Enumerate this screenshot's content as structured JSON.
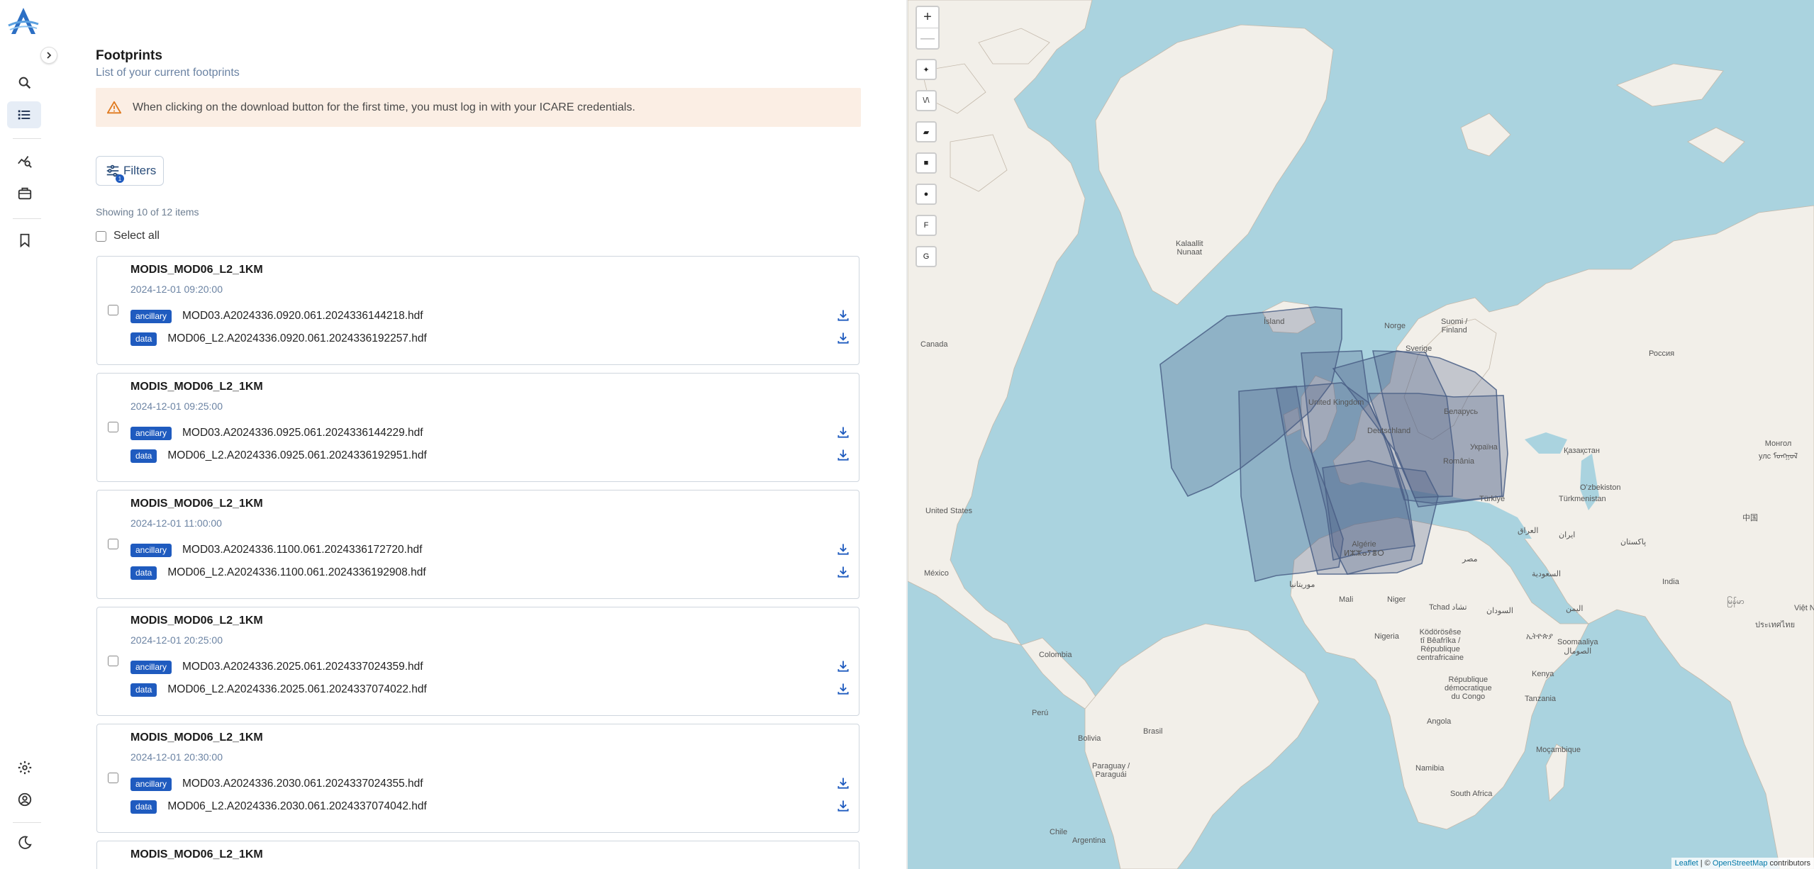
{
  "panel": {
    "title": "Footprints",
    "subtitle": "List of your current footprints",
    "alert_text": "When clicking on the download button for the first time, you must log in with your ICARE credentials.",
    "filters_label": "Filters",
    "filters_badge": "1",
    "showing": "Showing 10 of 12 items",
    "select_all": "Select all"
  },
  "tags": {
    "ancillary": "ancillary",
    "data": "data"
  },
  "cards": [
    {
      "title": "MODIS_MOD06_L2_1KM",
      "date": "2024-12-01 09:20:00",
      "ancillary_file": "MOD03.A2024336.0920.061.2024336144218.hdf",
      "data_file": "MOD06_L2.A2024336.0920.061.2024336192257.hdf"
    },
    {
      "title": "MODIS_MOD06_L2_1KM",
      "date": "2024-12-01 09:25:00",
      "ancillary_file": "MOD03.A2024336.0925.061.2024336144229.hdf",
      "data_file": "MOD06_L2.A2024336.0925.061.2024336192951.hdf"
    },
    {
      "title": "MODIS_MOD06_L2_1KM",
      "date": "2024-12-01 11:00:00",
      "ancillary_file": "MOD03.A2024336.1100.061.2024336172720.hdf",
      "data_file": "MOD06_L2.A2024336.1100.061.2024336192908.hdf"
    },
    {
      "title": "MODIS_MOD06_L2_1KM",
      "date": "2024-12-01 20:25:00",
      "ancillary_file": "MOD03.A2024336.2025.061.2024337024359.hdf",
      "data_file": "MOD06_L2.A2024336.2025.061.2024337074022.hdf"
    },
    {
      "title": "MODIS_MOD06_L2_1KM",
      "date": "2024-12-01 20:30:00",
      "ancillary_file": "MOD03.A2024336.2030.061.2024337024355.hdf",
      "data_file": "MOD06_L2.A2024336.2030.061.2024337074042.hdf"
    },
    {
      "title": "MODIS_MOD06_L2_1KM"
    }
  ],
  "map": {
    "zoom_in": "+",
    "zoom_out": "—",
    "tool_pin": "✦",
    "tool_polyline": "\\/\\",
    "tool_polygon": "▰",
    "tool_rectangle": "■",
    "tool_circle": "●",
    "tool_f": "F",
    "tool_g": "G",
    "labels": {
      "greenland": "Kalaallit\nNunaat",
      "island": "Ísland",
      "canada": "Canada",
      "norge": "Norge",
      "sverige": "Sverige",
      "suomi": "Suomi /\nFinland",
      "rossiya": "Россия",
      "kingdom": "Kingdom",
      "deutschland": "Deutschland",
      "belarus": "Беларусь",
      "ukraina": "Україна",
      "romania": "România",
      "kazakhstan": "Қазақстан",
      "mongol": "Монгол\nулс ᠮᠣᠩᠭᠣᠯ",
      "uzbekiston": "Oʻzbekiston",
      "turkmenistan": "Türkmenistan",
      "turkiye": "Türkiye",
      "us": "United States",
      "iraq": "العراق",
      "iran": "ایران",
      "pakistan": "پاکستان",
      "china": "中国",
      "mexico": "México",
      "misr": "مصر",
      "algerie": "Algérie\nⵍⵣⵣⴰⵢⴻⵔ",
      "mauritanie": "موريتانيا",
      "mali": "Mali",
      "niger": "Niger",
      "tchad": "Tchad تشاد",
      "sudan": "السودان",
      "saudi": "السعودية",
      "yemen": "اليمن",
      "india": "India",
      "vietnam": "Việt Nam",
      "myanmar": "မြန်မာ",
      "thailand": "ประเทศไทย",
      "nigeria": "Nigeria",
      "kodorosese": "Ködörösêse\ntî Bêafrîka /\nRépublique\ncentrafricaine",
      "ethiopia": "ኢትዮጵያ",
      "somalia": "Soomaaliya\nالصومال",
      "colombia": "Colombia",
      "rdc": "République\ndémocratique\ndu Congo",
      "kenya": "Kenya",
      "tanzania": "Tanzania",
      "peru": "Perú",
      "brasil": "Brasil",
      "bolivia": "Bolivia",
      "angola": "Angola",
      "mocambique": "Moçambique",
      "paraguay": "Paraguay /\nParaguái",
      "namibia": "Namibia",
      "southafrica": "South Africa",
      "chile": "Chile",
      "argentina": "Argentina",
      "kingdom_full": "United Kingdom"
    },
    "attribution_leaflet": "Leaflet",
    "attribution_sep": " | © ",
    "attribution_osm": "OpenStreetMap",
    "attribution_rest": " contributors"
  },
  "colors": {
    "accent": "#1f5bbf",
    "alert_bg": "#fbeee4",
    "map_water": "#aad3df",
    "map_land": "#f2efe9",
    "footprint": "#4a5f86"
  }
}
